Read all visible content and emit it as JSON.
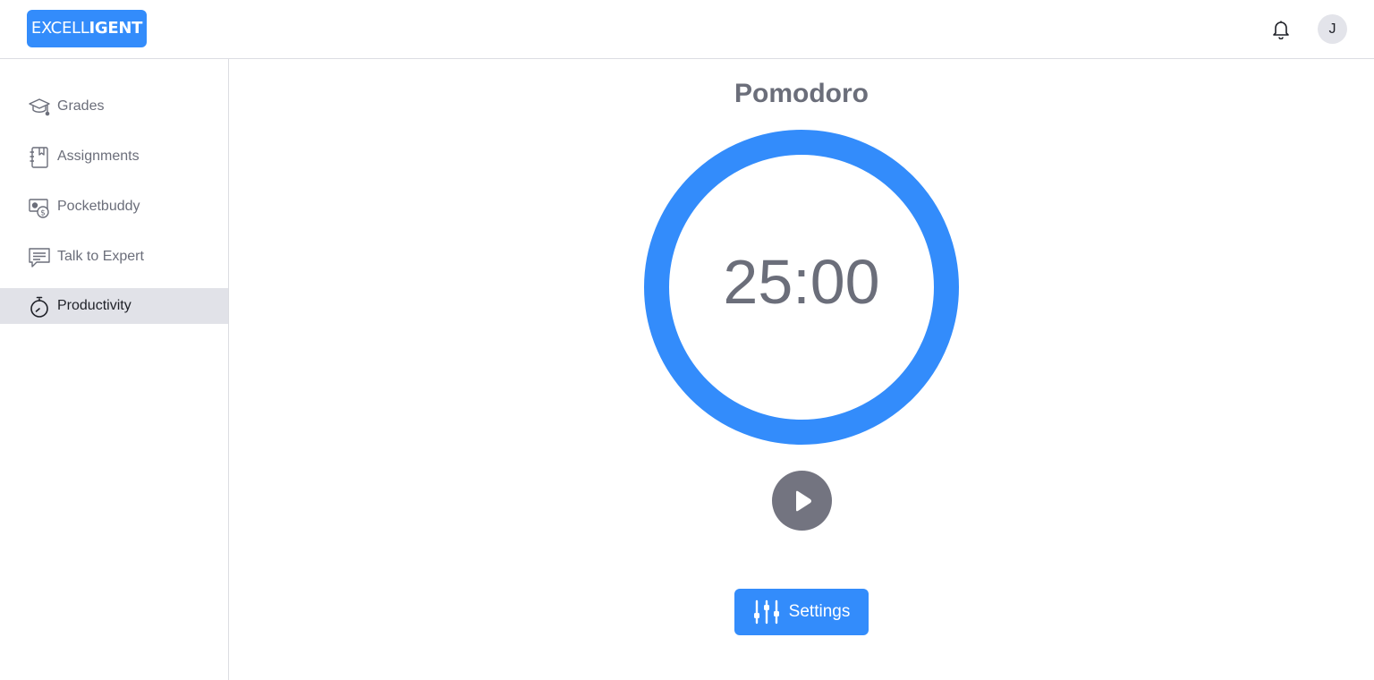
{
  "header": {
    "logo_light": "EXCELL",
    "logo_bold": "IGENT",
    "notification_icon": "bell-icon",
    "avatar_initial": "J"
  },
  "sidebar": {
    "items": [
      {
        "label": "Grades",
        "icon": "graduation-cap-icon",
        "active": false
      },
      {
        "label": "Assignments",
        "icon": "notebook-icon",
        "active": false
      },
      {
        "label": "Pocketbuddy",
        "icon": "money-icon",
        "active": false
      },
      {
        "label": "Talk to Expert",
        "icon": "chat-icon",
        "active": false
      },
      {
        "label": "Productivity",
        "icon": "stopwatch-icon",
        "active": true
      }
    ]
  },
  "main": {
    "title": "Pomodoro",
    "timer": "25:00",
    "play_icon": "play-icon",
    "settings_label": "Settings",
    "settings_icon": "sliders-icon"
  },
  "colors": {
    "accent": "#338cfb",
    "text_muted": "#6b6e7a",
    "active_bg": "#e1e2e8",
    "play_bg": "#737480"
  }
}
